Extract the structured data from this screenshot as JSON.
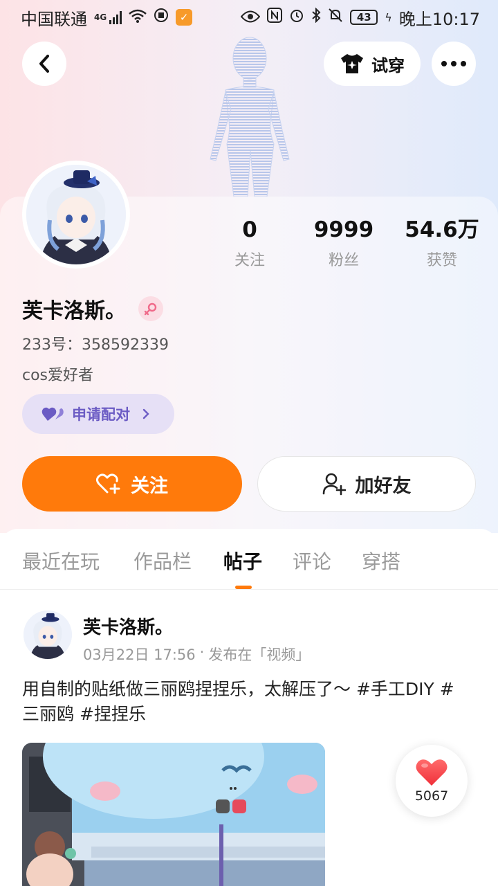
{
  "status_bar": {
    "carrier": "中国联通",
    "network": "4G",
    "battery": "43",
    "time": "晚上10:17"
  },
  "header": {
    "try_on_label": "试穿"
  },
  "profile": {
    "stats": [
      {
        "value": "0",
        "label": "关注"
      },
      {
        "value": "9999",
        "label": "粉丝"
      },
      {
        "value": "54.6万",
        "label": "获赞"
      }
    ],
    "name": "芙卡洛斯。",
    "gender": "female",
    "uid": "233号：358592339",
    "bio": "cos爱好者",
    "pair_label": "申请配对",
    "follow_label": "关注",
    "add_friend_label": "加好友"
  },
  "tabs": [
    {
      "label": "最近在玩",
      "active": false
    },
    {
      "label": "作品栏",
      "active": false
    },
    {
      "label": "帖子",
      "active": true
    },
    {
      "label": "评论",
      "active": false
    },
    {
      "label": "穿搭",
      "active": false
    }
  ],
  "post": {
    "author": "芙卡洛斯。",
    "date": "03月22日 17:56",
    "separator": "·",
    "channel": "发布在「视频」",
    "text": "用自制的贴纸做三丽鸥捏捏乐，太解压了～ #手工DIY #三丽鸥 #捏捏乐",
    "likes": "5067"
  },
  "colors": {
    "accent": "#ff7a0b",
    "pair_text": "#6b5bc4",
    "pair_bg": "#e6e0f6",
    "gender_pink": "#f06a8a"
  }
}
